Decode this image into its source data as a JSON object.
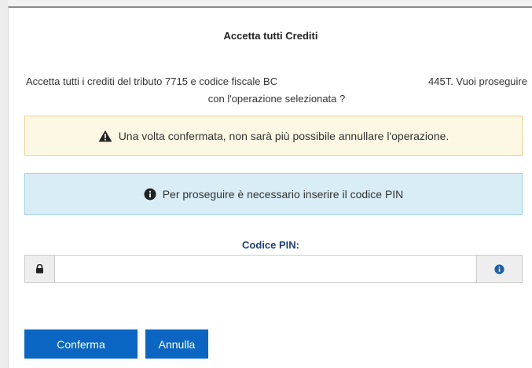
{
  "dialog": {
    "title": "Accetta tutti Crediti",
    "message_part1": "Accetta tutti i crediti del tributo 7715 e codice fiscale BC",
    "message_part2": "445T. Vuoi proseguire",
    "message_part3": "con l'operazione selezionata ?"
  },
  "warning": {
    "icon": "warning-triangle-icon",
    "text": "Una volta confermata, non sarà più possibile annullare l'operazione."
  },
  "info": {
    "icon": "info-circle-icon",
    "text": "Per proseguire è necessario inserire il codice PIN"
  },
  "pin": {
    "label": "Codice PIN:",
    "value": "",
    "placeholder": "",
    "left_icon": "lock-icon",
    "right_icon": "info-circle-icon"
  },
  "buttons": {
    "confirm": "Conferma",
    "cancel": "Annulla"
  },
  "colors": {
    "primary": "#0b66c3",
    "warning_bg": "#fcf8e3",
    "info_bg": "#d9edf7",
    "label": "#1f3d7a"
  }
}
